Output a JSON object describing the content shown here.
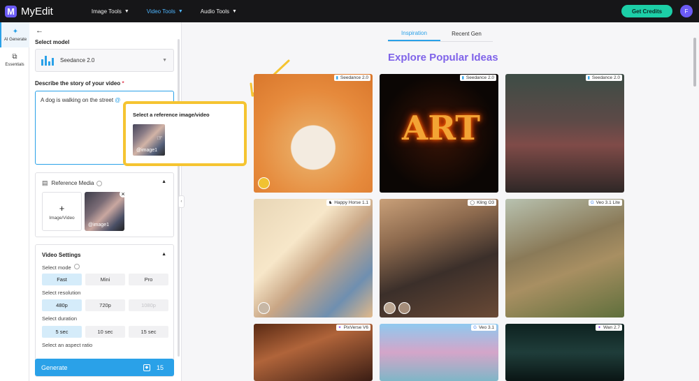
{
  "app": {
    "name": "MyEdit",
    "logo_letter": "M"
  },
  "nav": [
    {
      "label": "Image Tools",
      "active": false
    },
    {
      "label": "Video Tools",
      "active": true
    },
    {
      "label": "Audio Tools",
      "active": false
    }
  ],
  "header": {
    "get_credits": "Get Credits",
    "avatar_initial": "F"
  },
  "rail": [
    {
      "label": "AI Generate",
      "icon": "magic-wand-icon",
      "active": true
    },
    {
      "label": "Essentials",
      "icon": "layers-icon",
      "active": false
    }
  ],
  "panel": {
    "select_model_label": "Select model",
    "model_name": "Seedance 2.0",
    "describe_label": "Describe the story of your video",
    "required_mark": "*",
    "prompt_value": "A dog is walking on the street",
    "prompt_at": "@",
    "reference_media": {
      "title": "Reference Media",
      "add_label": "Image/Video",
      "thumb_tag": "@image1"
    },
    "video_settings": {
      "title": "Video Settings",
      "mode_label": "Select mode",
      "modes": [
        "Fast",
        "Mini",
        "Pro"
      ],
      "mode_selected": "Fast",
      "resolution_label": "Select resolution",
      "resolutions": [
        "480p",
        "720p",
        "1080p"
      ],
      "resolution_selected": "480p",
      "resolution_disabled": "1080p",
      "duration_label": "Select duration",
      "durations": [
        "5 sec",
        "10 sec",
        "15 sec"
      ],
      "duration_selected": "5 sec",
      "aspect_label": "Select an aspect ratio"
    },
    "generate": {
      "label": "Generate",
      "cost": "15"
    }
  },
  "popup": {
    "title": "Select a reference image/video",
    "thumb_tag": "@image1"
  },
  "main": {
    "tabs": [
      {
        "label": "Inspiration",
        "active": true
      },
      {
        "label": "Recent Gen",
        "active": false
      }
    ],
    "explore_title": "Explore Popular Ideas",
    "cards": [
      {
        "model": "Seedance 2.0",
        "icon": "chart-bars-icon"
      },
      {
        "model": "Seedance 2.0",
        "icon": "chart-bars-icon",
        "art_text": "ART"
      },
      {
        "model": "Seedance 2.0",
        "icon": "chart-bars-icon"
      },
      {
        "model": "Happy Horse 1.1",
        "icon": "horse-icon"
      },
      {
        "model": "Kling O3",
        "icon": "kling-icon"
      },
      {
        "model": "Veo 3.1 Lite",
        "icon": "google-icon"
      },
      {
        "model": "PixVerse V6",
        "icon": "pixverse-icon"
      },
      {
        "model": "Veo 3.1",
        "icon": "google-icon"
      },
      {
        "model": "Wan 2.7",
        "icon": "wan-icon"
      }
    ]
  },
  "colors": {
    "accent": "#2aa1e8",
    "brand": "#6b5bf5",
    "credits": "#1ccfa7",
    "highlight": "#f5c431",
    "explore_title": "#7f63e9"
  }
}
